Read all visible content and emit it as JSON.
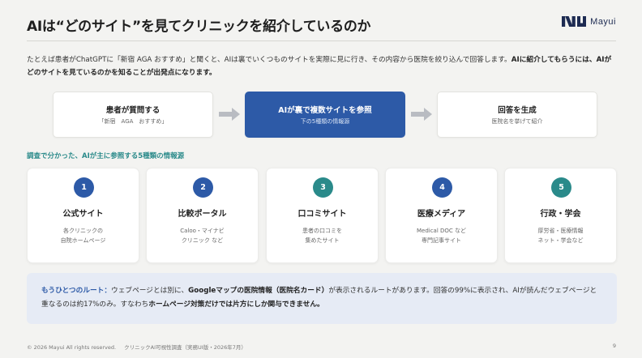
{
  "header": {
    "title": "AIは“どのサイト”を見てクリニックを紹介しているのか",
    "logo_text": "Mayui"
  },
  "intro": {
    "normal_1": "たとえば患者がChatGPTに「新宿 AGA おすすめ」と聞くと、AIは裏でいくつものサイトを実際に見に行き、その内容から医院を絞り込んで回答します。",
    "bold_1": "AIに紹介してもらうには、AIがどのサイトを見ているのかを知ることが出発点になります。"
  },
  "flow": [
    {
      "title": "患者が質問する",
      "sub": "「新宿　AGA　おすすめ」"
    },
    {
      "title": "AIが裏で複数サイトを参照",
      "sub": "下の5種類の情報源"
    },
    {
      "title": "回答を生成",
      "sub": "医院名を挙げて紹介"
    }
  ],
  "section_label": "調査で分かった、AIが主に参照する5種類の情報源",
  "sources": [
    {
      "num": "1",
      "title": "公式サイト",
      "desc1": "各クリニックの",
      "desc2": "自院ホームページ",
      "color": "#2d5aa7"
    },
    {
      "num": "2",
      "title": "比較ポータル",
      "desc1": "Caloo・マイナビ",
      "desc2": "クリニック など",
      "color": "#2d5aa7"
    },
    {
      "num": "3",
      "title": "口コミサイト",
      "desc1": "患者の口コミを",
      "desc2": "集めたサイト",
      "color": "#2a8a8a"
    },
    {
      "num": "4",
      "title": "医療メディア",
      "desc1": "Medical DOC など",
      "desc2": "専門記事サイト",
      "color": "#2d5aa7"
    },
    {
      "num": "5",
      "title": "行政・学会",
      "desc1": "厚労省・医療情報",
      "desc2": "ネット・学会など",
      "color": "#2a8a8a"
    }
  ],
  "note": {
    "lead": "もうひとつのルート：",
    "t1": "ウェブページとは別に、",
    "b1": "Googleマップの医院情報（医院名カード）",
    "t2": "が表示されるルートがあります。回答の99%に表示され、AIが読んだウェブページと重なるのは約17%のみ。すなわち",
    "b2": "ホームページ対策だけでは片方にしか関与できません。"
  },
  "footer": {
    "copyright": "© 2026 Mayui All rights reserved.",
    "report": "クリニックAI可視性調査（実務UI版・2026年7月）",
    "page": "9"
  },
  "colors": {
    "primary": "#2d5aa7",
    "accent": "#2a8a8a",
    "note_bg": "#e6ebf5"
  }
}
